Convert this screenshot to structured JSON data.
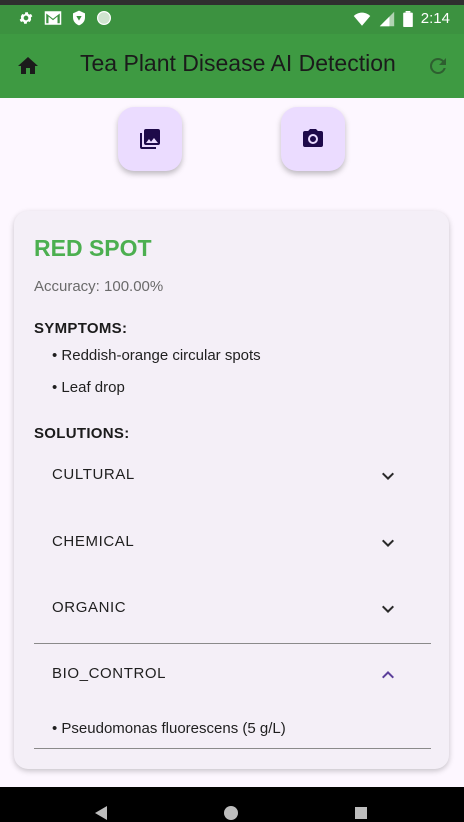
{
  "status_bar": {
    "time": "2:14",
    "icons_left": [
      "settings-icon",
      "gmail-icon",
      "shield-icon",
      "circle-icon"
    ],
    "icons_right": [
      "wifi-icon",
      "signal-icon",
      "battery-icon"
    ]
  },
  "app_bar": {
    "title": "Tea Plant Disease AI  Detection",
    "home_icon": "home-icon",
    "refresh_icon": "refresh-icon",
    "color": "#3e9a42"
  },
  "actions": {
    "gallery_icon": "gallery-icon",
    "camera_icon": "camera-icon"
  },
  "result": {
    "disease": "RED SPOT",
    "accuracy": "Accuracy: 100.00%",
    "symptoms_title": "SYMPTOMS:",
    "symptoms": [
      "• Reddish-orange circular spots",
      "• Leaf drop"
    ],
    "solutions_title": "SOLUTIONS:",
    "solutions": [
      {
        "label": "CULTURAL",
        "expanded": false
      },
      {
        "label": "CHEMICAL",
        "expanded": false
      },
      {
        "label": "ORGANIC",
        "expanded": false
      },
      {
        "label": "BIO_CONTROL",
        "expanded": true,
        "items": [
          "• Pseudomonas fluorescens (5 g/L)"
        ]
      }
    ],
    "accent_color": "#4caf50"
  },
  "nav_bar": {
    "icons": [
      "back-icon",
      "home-circle-icon",
      "recents-icon"
    ]
  }
}
